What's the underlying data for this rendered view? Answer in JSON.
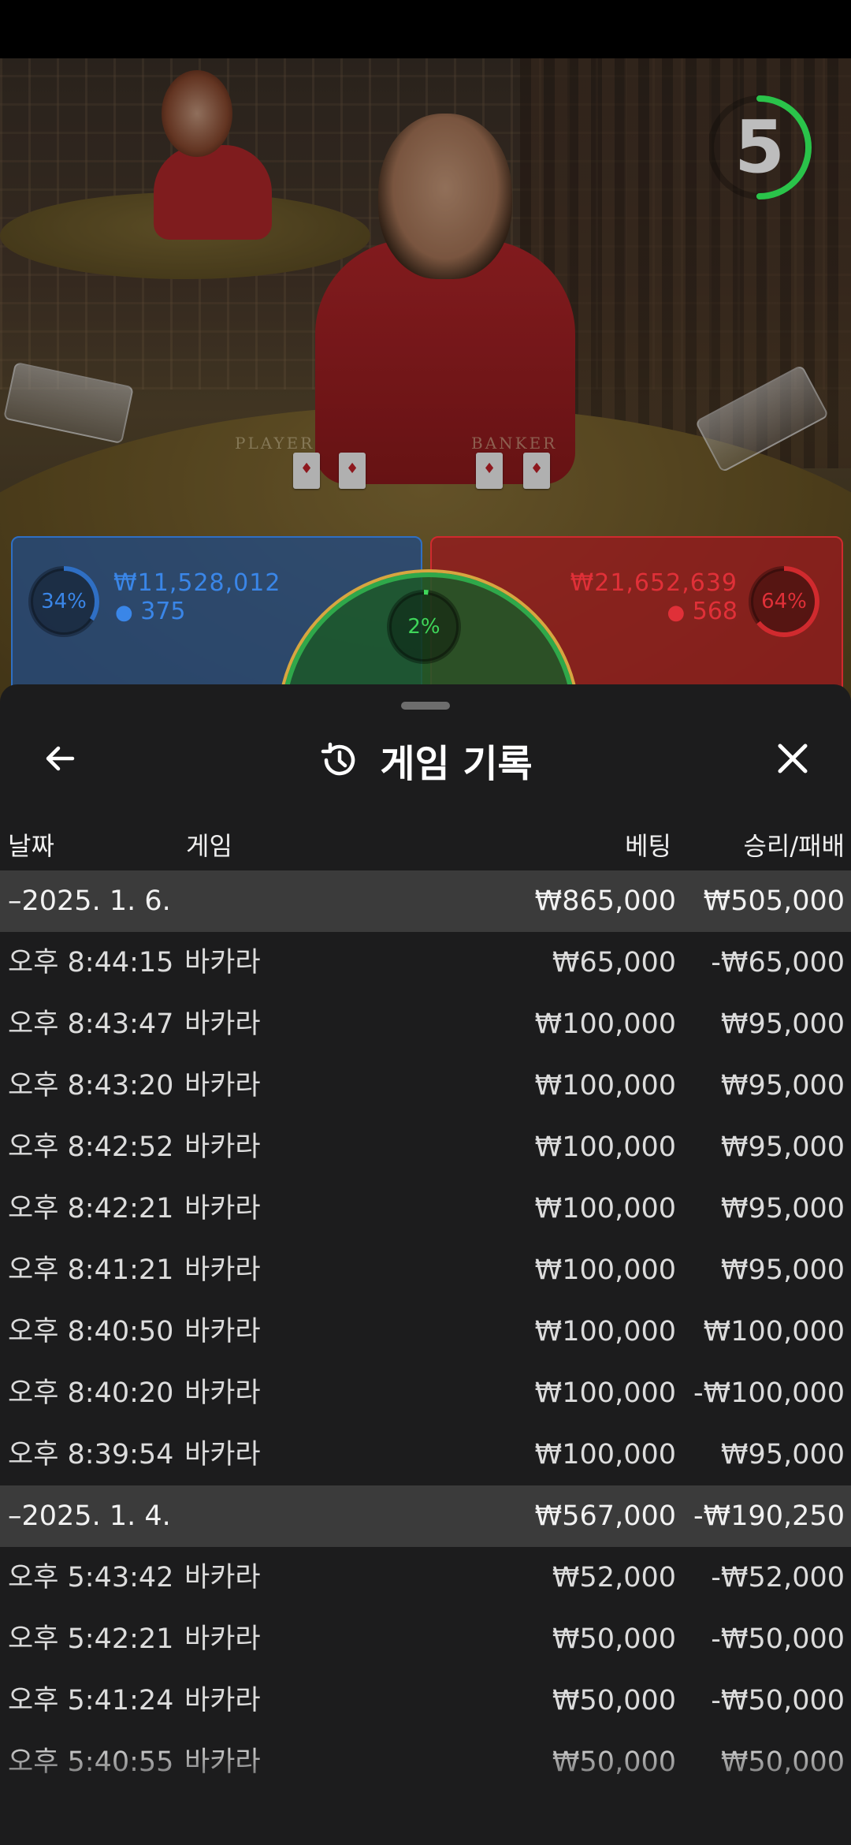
{
  "countdown": {
    "value": "5",
    "progress": 0.5
  },
  "table_labels": {
    "player": "PLAYER",
    "banker": "BANKER"
  },
  "player_panel": {
    "percent": "34%",
    "percent_value": 0.34,
    "amount": "₩11,528,012",
    "count": "375",
    "color": "#2f6fc4"
  },
  "banker_panel": {
    "percent": "64%",
    "percent_value": 0.64,
    "amount": "₩21,652,639",
    "count": "568",
    "color": "#d02a2e"
  },
  "tie_panel": {
    "percent": "2%",
    "percent_value": 0.02,
    "color": "#3fd65a"
  },
  "sheet": {
    "title": "게임 기록",
    "back_icon": "arrow-left-icon",
    "history_icon": "history-clock-icon",
    "close_icon": "close-icon"
  },
  "columns": {
    "date": "날짜",
    "game": "게임",
    "bet": "베팅",
    "result": "승리/패배"
  },
  "rows": [
    {
      "type": "date",
      "date": "–2025. 1. 6.",
      "game": "",
      "bet": "₩865,000",
      "result": "₩505,000"
    },
    {
      "type": "entry",
      "date": "오후 8:44:15",
      "game": "바카라",
      "bet": "₩65,000",
      "result": "-₩65,000"
    },
    {
      "type": "entry",
      "date": "오후 8:43:47",
      "game": "바카라",
      "bet": "₩100,000",
      "result": "₩95,000"
    },
    {
      "type": "entry",
      "date": "오후 8:43:20",
      "game": "바카라",
      "bet": "₩100,000",
      "result": "₩95,000"
    },
    {
      "type": "entry",
      "date": "오후 8:42:52",
      "game": "바카라",
      "bet": "₩100,000",
      "result": "₩95,000"
    },
    {
      "type": "entry",
      "date": "오후 8:42:21",
      "game": "바카라",
      "bet": "₩100,000",
      "result": "₩95,000"
    },
    {
      "type": "entry",
      "date": "오후 8:41:21",
      "game": "바카라",
      "bet": "₩100,000",
      "result": "₩95,000"
    },
    {
      "type": "entry",
      "date": "오후 8:40:50",
      "game": "바카라",
      "bet": "₩100,000",
      "result": "₩100,000"
    },
    {
      "type": "entry",
      "date": "오후 8:40:20",
      "game": "바카라",
      "bet": "₩100,000",
      "result": "-₩100,000"
    },
    {
      "type": "entry",
      "date": "오후 8:39:54",
      "game": "바카라",
      "bet": "₩100,000",
      "result": "₩95,000"
    },
    {
      "type": "date",
      "date": "–2025. 1. 4.",
      "game": "",
      "bet": "₩567,000",
      "result": "-₩190,250"
    },
    {
      "type": "entry",
      "date": "오후 5:43:42",
      "game": "바카라",
      "bet": "₩52,000",
      "result": "-₩52,000"
    },
    {
      "type": "entry",
      "date": "오후 5:42:21",
      "game": "바카라",
      "bet": "₩50,000",
      "result": "-₩50,000"
    },
    {
      "type": "entry",
      "date": "오후 5:41:24",
      "game": "바카라",
      "bet": "₩50,000",
      "result": "-₩50,000"
    },
    {
      "type": "entry",
      "date": "오후 5:40:55",
      "game": "바카라",
      "bet": "₩50,000",
      "result": "₩50,000"
    }
  ]
}
